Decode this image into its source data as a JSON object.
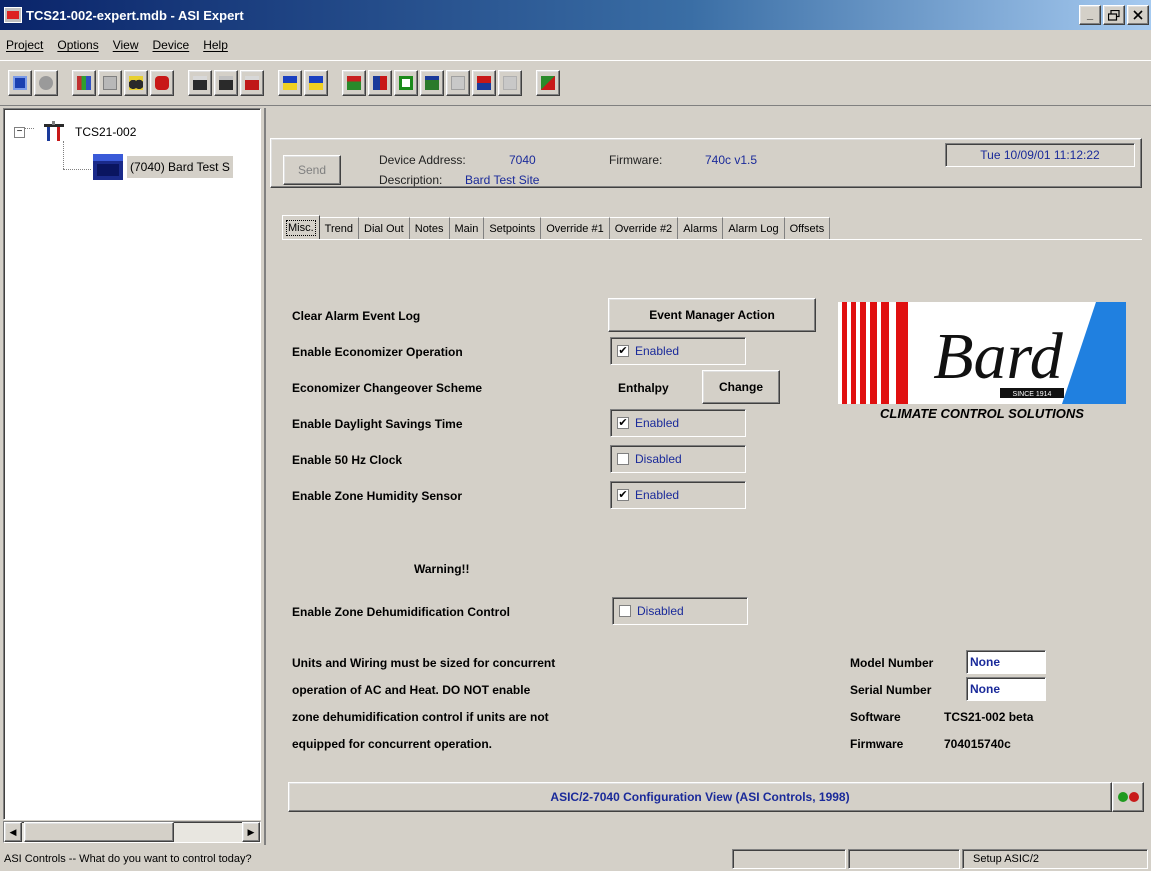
{
  "window": {
    "title": "TCS21-002-expert.mdb - ASI Expert",
    "controls": [
      "_",
      "%",
      "×"
    ]
  },
  "menu": [
    "Project",
    "Options",
    "View",
    "Device",
    "Help"
  ],
  "toolbar": {
    "groups": [
      [
        "monitor-icon",
        "disk-icon"
      ],
      [
        "chart-icon",
        "table-icon",
        "binoculars-icon",
        "stop-icon"
      ],
      [
        "save-icon",
        "save-all-icon",
        "save-red-icon"
      ],
      [
        "dos-icon",
        "dos-down-icon"
      ],
      [
        "home-icon",
        "temp-icon",
        "square-icon",
        "window-icon",
        "grid-icon",
        "alarm-icon",
        "disabled-grid-icon"
      ],
      [
        "tools-icon"
      ]
    ]
  },
  "tree": {
    "root_label": "TCS21-002",
    "child_label": "(7040) Bard Test S"
  },
  "header": {
    "send_label": "Send",
    "device_address_label": "Device Address:",
    "device_address_value": "7040",
    "firmware_label": "Firmware:",
    "firmware_value": "740c v1.5",
    "description_label": "Description:",
    "description_value": "Bard Test Site",
    "datetime": "Tue 10/09/01 11:12:22"
  },
  "tabs": [
    "Misc.",
    "Trend",
    "Dial Out",
    "Notes",
    "Main",
    "Setpoints",
    "Override #1",
    "Override #2",
    "Alarms",
    "Alarm Log",
    "Offsets"
  ],
  "settings": {
    "clear_alarm_label": "Clear Alarm Event Log",
    "event_manager_button": "Event Manager Action",
    "economizer_label": "Enable Economizer Operation",
    "economizer_state": "Enabled",
    "changeover_label": "Economizer Changeover Scheme",
    "changeover_value": "Enthalpy",
    "change_button": "Change",
    "dst_label": "Enable Daylight Savings Time",
    "dst_state": "Enabled",
    "clock50_label": "Enable 50 Hz Clock",
    "clock50_state": "Disabled",
    "zone_humidity_label": "Enable Zone Humidity Sensor",
    "zone_humidity_state": "Enabled",
    "warning_title": "Warning!!",
    "dehumid_label": "Enable Zone Dehumidification Control",
    "dehumid_state": "Disabled",
    "warning_lines": [
      "Units and Wiring must be sized for concurrent",
      "operation of AC and Heat. DO NOT enable",
      "zone dehumidification control if units are not",
      "equipped for concurrent operation."
    ]
  },
  "logo": {
    "wordmark": "Bard",
    "since_badge": "SINCE 1914",
    "tagline": "CLIMATE CONTROL SOLUTIONS",
    "accent_colors": [
      "#e01010",
      "#2080e0"
    ]
  },
  "info": {
    "model_label": "Model Number",
    "model_value": "None",
    "serial_label": "Serial Number",
    "serial_value": "None",
    "software_label": "Software",
    "software_value": "TCS21-002 beta",
    "firmware_label": "Firmware",
    "firmware_value": "704015740c"
  },
  "panel_status": {
    "caption": "ASIC/2-7040 Configuration View (ASI Controls, 1998)",
    "led_colors": [
      "#1f9a1f",
      "#c81a1a"
    ]
  },
  "status_bar": {
    "message": "ASI Controls -- What do you want to control today?",
    "right": "Setup ASIC/2"
  }
}
